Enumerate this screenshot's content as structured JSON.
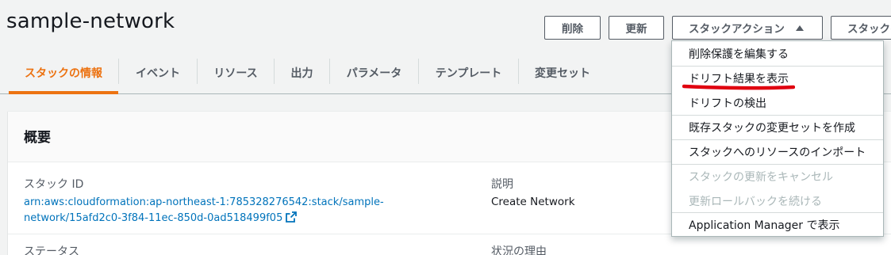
{
  "page": {
    "title": "sample-network"
  },
  "toolbar": {
    "delete_label": "削除",
    "update_label": "更新",
    "actions_label": "スタックアクション",
    "create_label": "スタックの作成"
  },
  "tabs": [
    {
      "label": "スタックの情報",
      "active": true
    },
    {
      "label": "イベント"
    },
    {
      "label": "リソース"
    },
    {
      "label": "出力"
    },
    {
      "label": "パラメータ"
    },
    {
      "label": "テンプレート"
    },
    {
      "label": "変更セット"
    }
  ],
  "overview": {
    "title": "概要",
    "stack_id_label": "スタック ID",
    "stack_id_value": "arn:aws:cloudformation:ap-northeast-1:785328276542:stack/sample-network/15afd2c0-3f84-11ec-850d-0ad518499f05",
    "description_label": "説明",
    "description_value": "Create Network",
    "status_label": "ステータス",
    "status_reason_label": "状況の理由"
  },
  "actions_menu": {
    "items": [
      {
        "label": "削除保護を編集する",
        "enabled": true
      },
      {
        "label": "ドリフト結果を表示",
        "enabled": true,
        "highlighted": true
      },
      {
        "label": "ドリフトの検出",
        "enabled": true
      },
      {
        "label": "既存スタックの変更セットを作成",
        "enabled": true
      },
      {
        "label": "スタックへのリソースのインポート",
        "enabled": true
      },
      {
        "label": "スタックの更新をキャンセル",
        "enabled": false
      },
      {
        "label": "更新ロールバックを続ける",
        "enabled": false
      },
      {
        "label": "Application Manager で表示",
        "enabled": true
      }
    ]
  },
  "colors": {
    "accent": "#ec7211",
    "link": "#0073bb",
    "highlight_underline": "#e0000f",
    "disabled": "#aab7b8"
  },
  "icons": [
    "external-link-icon",
    "caret-up-icon"
  ]
}
